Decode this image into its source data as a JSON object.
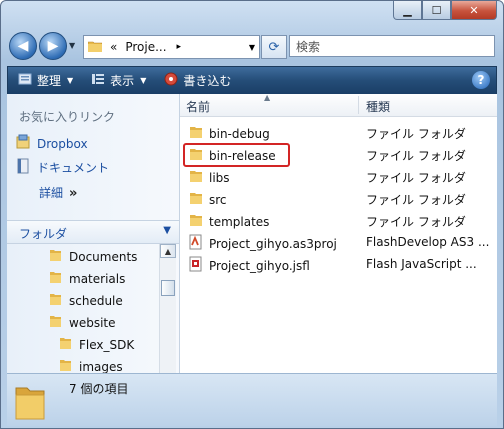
{
  "window": {
    "caption_buttons": {
      "minimize": "▁",
      "maximize": "☐",
      "close": "✕"
    }
  },
  "address": {
    "path_prefix": "«",
    "path_text": "Proje...",
    "path_arrow": "▸",
    "search_placeholder": "検索"
  },
  "toolbar": {
    "organize": "整理",
    "views": "表示",
    "burn": "書き込む",
    "help": "?"
  },
  "favorites": {
    "title": "お気に入りリンク",
    "items": [
      {
        "label": "Dropbox",
        "icon": "dropbox-icon"
      },
      {
        "label": "ドキュメント",
        "icon": "documents-icon"
      }
    ],
    "more_label": "詳細",
    "more_glyph": "»"
  },
  "folders": {
    "header": "フォルダ",
    "tree": [
      {
        "label": "Documents",
        "level": 2
      },
      {
        "label": "materials",
        "level": 2
      },
      {
        "label": "schedule",
        "level": 2
      },
      {
        "label": "website",
        "level": 2
      },
      {
        "label": "Flex_SDK",
        "level": 3
      },
      {
        "label": "images",
        "level": 3
      }
    ]
  },
  "file_list": {
    "columns": {
      "name": "名前",
      "type": "種類"
    },
    "rows": [
      {
        "name": "bin-debug",
        "type": "ファイル フォルダ",
        "icon": "folder-icon"
      },
      {
        "name": "bin-release",
        "type": "ファイル フォルダ",
        "icon": "folder-icon",
        "highlighted": true
      },
      {
        "name": "libs",
        "type": "ファイル フォルダ",
        "icon": "folder-icon"
      },
      {
        "name": "src",
        "type": "ファイル フォルダ",
        "icon": "folder-icon"
      },
      {
        "name": "templates",
        "type": "ファイル フォルダ",
        "icon": "folder-icon"
      },
      {
        "name": "Project_gihyo.as3proj",
        "type": "FlashDevelop AS3 ...",
        "icon": "as3proj-file-icon"
      },
      {
        "name": "Project_gihyo.jsfl",
        "type": "Flash JavaScript ...",
        "icon": "jsfl-file-icon"
      }
    ]
  },
  "status_bar": {
    "item_count": "7 個の項目"
  },
  "colors": {
    "highlight_border": "#d32525",
    "link": "#1c4fa1",
    "toolbar": "#254d78"
  }
}
